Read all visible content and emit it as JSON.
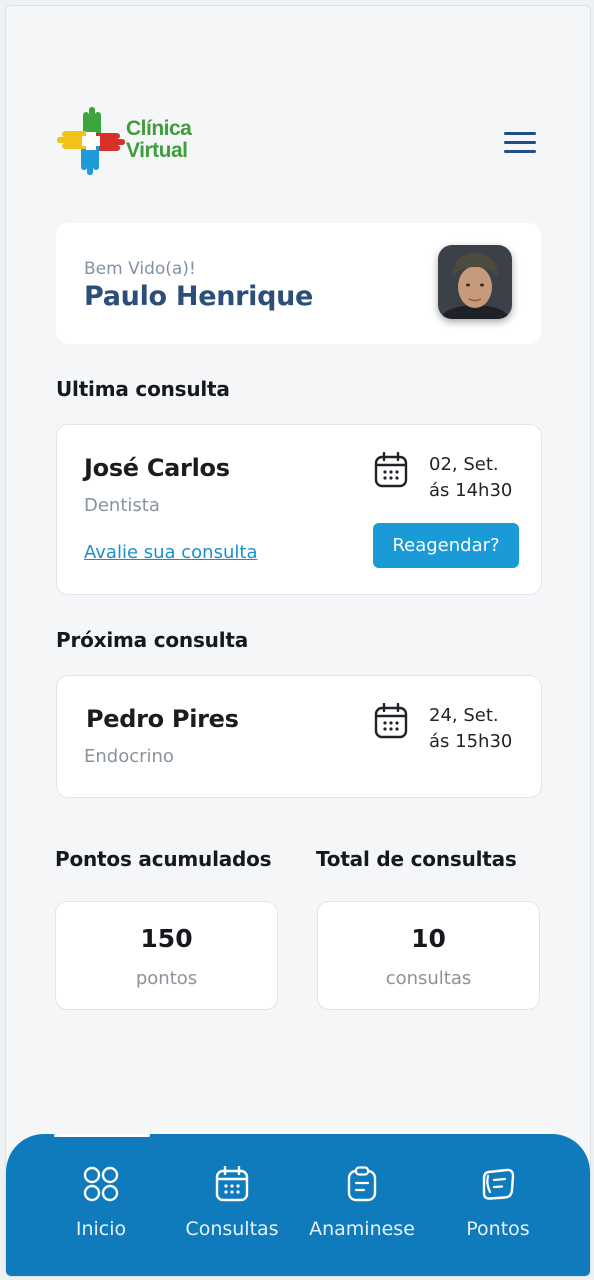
{
  "app": {
    "logo_line1": "Clínica",
    "logo_line2": "Virtual"
  },
  "welcome": {
    "greeting": "Bem Vido(a)!",
    "user_name": "Paulo Henrique"
  },
  "last_consult": {
    "section_title": "Ultima consulta",
    "doctor": "José Carlos",
    "specialty": "Dentista",
    "date_line1": "02, Set.",
    "date_line2": "ás 14h30",
    "rate_link": "Avalie sua consulta",
    "reschedule_button": "Reagendar?"
  },
  "next_consult": {
    "section_title": "Próxima consulta",
    "doctor": "Pedro Pires",
    "specialty": "Endocrino",
    "date_line1": "24, Set.",
    "date_line2": "ás 15h30"
  },
  "stats": {
    "points_title": "Pontos acumulados",
    "points_value": "150",
    "points_unit": "pontos",
    "consults_title": "Total de consultas",
    "consults_value": "10",
    "consults_unit": "consultas"
  },
  "bottom_nav": {
    "items": [
      {
        "label": "Inicio",
        "icon": "grid-icon",
        "active": true
      },
      {
        "label": "Consultas",
        "icon": "calendar-icon",
        "active": false
      },
      {
        "label": "Anaminese",
        "icon": "clipboard-icon",
        "active": false
      },
      {
        "label": "Pontos",
        "icon": "points-icon",
        "active": false
      }
    ]
  },
  "colors": {
    "primary": "#0f7bbd",
    "button": "#1a9ad6",
    "brand_green": "#3f9d3a",
    "name_blue": "#2b4f78"
  }
}
